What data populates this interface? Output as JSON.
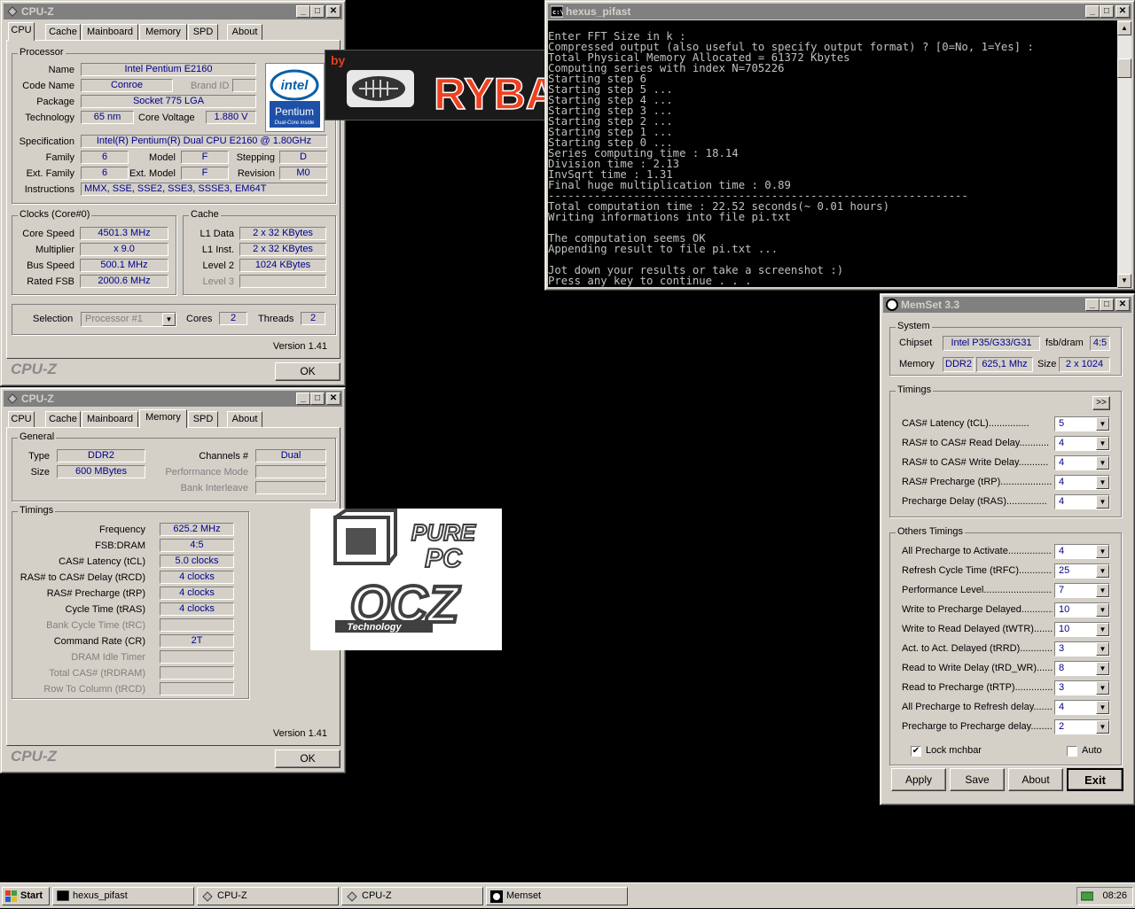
{
  "cpuz1": {
    "title": "CPU-Z",
    "tabs": [
      "CPU",
      "Cache",
      "Mainboard",
      "Memory",
      "SPD",
      "About"
    ],
    "processor": {
      "group": "Processor",
      "name_label": "Name",
      "name": "Intel Pentium E2160",
      "codename_label": "Code Name",
      "codename": "Conroe",
      "brandid_label": "Brand ID",
      "package_label": "Package",
      "package": "Socket 775 LGA",
      "technology_label": "Technology",
      "technology": "65 nm",
      "voltage_label": "Core Voltage",
      "voltage": "1.880 V",
      "spec_label": "Specification",
      "spec": "Intel(R) Pentium(R) Dual  CPU  E2160  @ 1.80GHz",
      "family_label": "Family",
      "family": "6",
      "model_label": "Model",
      "model": "F",
      "stepping_label": "Stepping",
      "stepping": "D",
      "extfamily_label": "Ext. Family",
      "extfamily": "6",
      "extmodel_label": "Ext. Model",
      "extmodel": "F",
      "revision_label": "Revision",
      "revision": "M0",
      "instructions_label": "Instructions",
      "instructions": "MMX, SSE, SSE2, SSE3, SSSE3, EM64T"
    },
    "clocks": {
      "group": "Clocks (Core#0)",
      "corespeed_label": "Core Speed",
      "corespeed": "4501.3 MHz",
      "multiplier_label": "Multiplier",
      "multiplier": "x 9.0",
      "busspeed_label": "Bus Speed",
      "busspeed": "500.1 MHz",
      "ratedfsb_label": "Rated FSB",
      "ratedfsb": "2000.6 MHz"
    },
    "cache": {
      "group": "Cache",
      "l1data_label": "L1 Data",
      "l1data": "2 x 32 KBytes",
      "l1inst_label": "L1 Inst.",
      "l1inst": "2 x 32 KBytes",
      "level2_label": "Level 2",
      "level2": "1024 KBytes",
      "level3_label": "Level 3"
    },
    "selection_label": "Selection",
    "selection": "Processor #1",
    "cores_label": "Cores",
    "cores": "2",
    "threads_label": "Threads",
    "threads": "2",
    "version": "Version 1.41",
    "brand": "CPU-Z",
    "ok": "OK",
    "intel_logo": {
      "line1": "intel",
      "line2": "Pentium",
      "line3": "Dual-Core inside"
    }
  },
  "cpuz2": {
    "title": "CPU-Z",
    "tabs": [
      "CPU",
      "Cache",
      "Mainboard",
      "Memory",
      "SPD",
      "About"
    ],
    "general": {
      "group": "General",
      "type_label": "Type",
      "type": "DDR2",
      "channels_label": "Channels #",
      "channels": "Dual",
      "size_label": "Size",
      "size": "600 MBytes",
      "perfmode_label": "Performance Mode",
      "bankinterleave_label": "Bank Interleave"
    },
    "timings": {
      "group": "Timings",
      "rows": [
        {
          "label": "Frequency",
          "value": "625.2 MHz",
          "disabled": false
        },
        {
          "label": "FSB:DRAM",
          "value": "4:5",
          "disabled": false
        },
        {
          "label": "CAS# Latency (tCL)",
          "value": "5.0 clocks",
          "disabled": false
        },
        {
          "label": "RAS# to CAS# Delay (tRCD)",
          "value": "4 clocks",
          "disabled": false
        },
        {
          "label": "RAS# Precharge (tRP)",
          "value": "4 clocks",
          "disabled": false
        },
        {
          "label": "Cycle Time (tRAS)",
          "value": "4 clocks",
          "disabled": false
        },
        {
          "label": "Bank Cycle Time (tRC)",
          "value": "",
          "disabled": true
        },
        {
          "label": "Command Rate (CR)",
          "value": "2T",
          "disabled": false
        },
        {
          "label": "DRAM Idle Timer",
          "value": "",
          "disabled": true
        },
        {
          "label": "Total CAS# (tRDRAM)",
          "value": "",
          "disabled": true
        },
        {
          "label": "Row To Column (tRCD)",
          "value": "",
          "disabled": true
        }
      ]
    },
    "version": "Version 1.41",
    "brand": "CPU-Z",
    "ok": "OK"
  },
  "ryba_logo": {
    "by": "by",
    "text": "RYBA"
  },
  "purepc_logo": {
    "pure": "PURE",
    "pc": "PC",
    "ocz": "OCZ",
    "tech": "Technology"
  },
  "console": {
    "title": "hexus_pifast",
    "lines": [
      "",
      "Enter FFT Size in k :",
      "Compressed output (also useful to specify output format) ? [0=No, 1=Yes] :",
      "Total Physical Memory Allocated = 61372 Kbytes",
      "Computing series with index N=705226",
      "Starting step 6",
      "Starting step 5 ...",
      "Starting step 4 ...",
      "Starting step 3 ...",
      "Starting step 2 ...",
      "Starting step 1 ...",
      "Starting step 0 ...",
      "Series computing time : 18.14",
      "Division time : 2.13",
      "InvSqrt time : 1.31",
      "Final huge multiplication time : 0.89",
      "----------------------------------------------------------------",
      "Total computation time : 22.52 seconds(~ 0.01 hours)",
      "Writing informations into file pi.txt",
      "",
      "The computation seems OK",
      "Appending result to file pi.txt ...",
      "",
      "Jot down your results or take a screenshot :)",
      "Press any key to continue . . ."
    ]
  },
  "memset": {
    "title": "MemSet 3.3",
    "system_group": "System",
    "chipset_label": "Chipset",
    "chipset": "Intel P35/G33/G31",
    "fsbdram_label": "fsb/dram",
    "fsbdram": "4:5",
    "memory_label": "Memory",
    "memory_type": "DDR2",
    "memory_freq": "625,1 Mhz",
    "size_label": "Size",
    "size": "2 x 1024",
    "timings_group": "Timings",
    "expand": ">>",
    "timings": [
      {
        "label": "CAS# Latency (tCL)...............",
        "value": "5"
      },
      {
        "label": "RAS# to CAS# Read Delay...........",
        "value": "4"
      },
      {
        "label": "RAS# to CAS# Write Delay...........",
        "value": "4"
      },
      {
        "label": "RAS# Precharge (tRP)...................",
        "value": "4"
      },
      {
        "label": "Precharge Delay  (tRAS)...............",
        "value": "4"
      }
    ],
    "others_group": "Others Timings",
    "others": [
      {
        "label": "All Precharge to Activate..................",
        "value": "4"
      },
      {
        "label": "Refresh Cycle Time (tRFC)...............",
        "value": "25"
      },
      {
        "label": "Performance Level............................",
        "value": "7"
      },
      {
        "label": "Write to Precharge Delayed................",
        "value": "10"
      },
      {
        "label": "Write to Read Delayed (tWTR)..........",
        "value": "10"
      },
      {
        "label": "Act. to Act. Delayed (tRRD)...............",
        "value": "3"
      },
      {
        "label": "Read to Write Delay (tRD_WR)..........",
        "value": "8"
      },
      {
        "label": "Read to Precharge (tRTP)..................",
        "value": "3"
      },
      {
        "label": "All Precharge to Refresh delay..........",
        "value": "4"
      },
      {
        "label": "Precharge to Precharge delay............",
        "value": "2"
      }
    ],
    "lock_label": "Lock mchbar",
    "lock_checked": true,
    "auto_label": "Auto",
    "auto_checked": false,
    "apply": "Apply",
    "save": "Save",
    "about": "About",
    "exit": "Exit"
  },
  "taskbar": {
    "start": "Start",
    "items": [
      "hexus_pifast",
      "CPU-Z",
      "CPU-Z",
      "Memset"
    ],
    "clock": "08:26"
  }
}
